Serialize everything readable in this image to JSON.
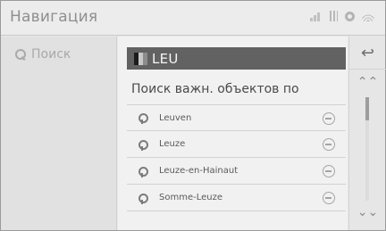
{
  "header": {
    "title": "Навигация",
    "status_icons": [
      "signal-icon",
      "storage-bars-icon",
      "settings-icon",
      "wifi-icon"
    ]
  },
  "sidebar": {
    "search_label": "Поиск"
  },
  "search": {
    "value": "LEU",
    "country_flag": "flag-icon"
  },
  "results": {
    "title": "Поиск важн. объектов по",
    "items": [
      {
        "label": "Leuven"
      },
      {
        "label": "Leuze"
      },
      {
        "label": "Leuze-en-Hainaut"
      },
      {
        "label": "Somme-Leuze"
      }
    ]
  },
  "controls": {
    "back_icon": "↩",
    "scroll_up_icon": "⌃⌃",
    "scroll_down_icon": "⌄⌄"
  },
  "colors": {
    "input_bg": "#626262",
    "panel_bg": "#f1f1f1",
    "sidebar_bg": "#e1e1e1"
  }
}
